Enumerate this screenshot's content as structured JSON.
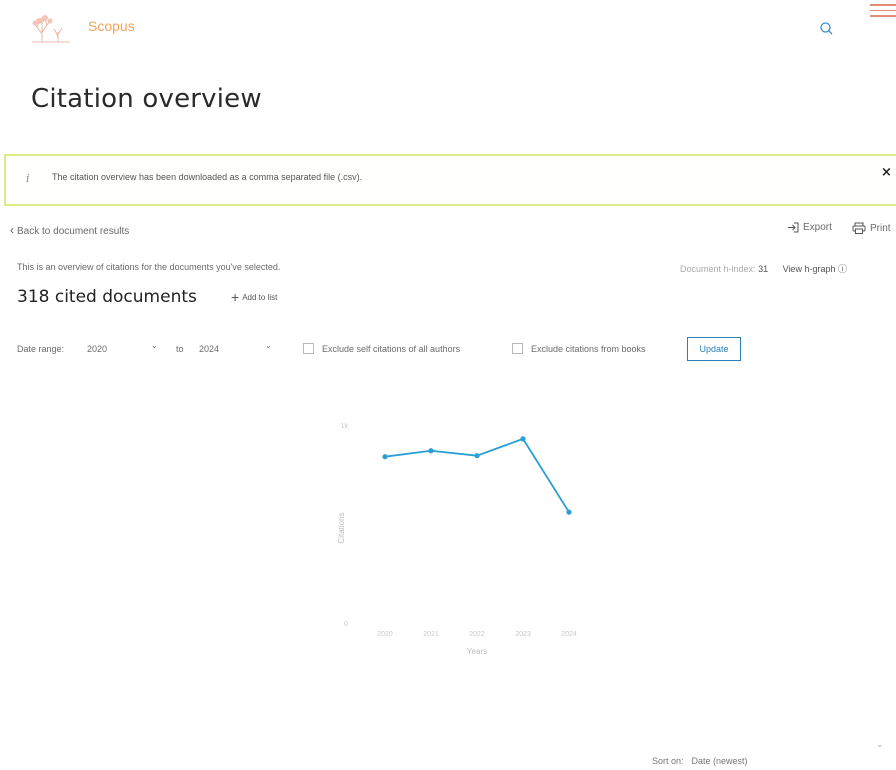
{
  "header": {
    "brand": "Scopus",
    "logo_icon": "tree-logo-icon",
    "search_icon": "search-icon",
    "menu_icon": "hamburger-menu-icon"
  },
  "page": {
    "title": "Citation overview"
  },
  "alert": {
    "icon": "i",
    "message": "The citation overview has been downloaded as a comma separated file (.csv).",
    "close": "×"
  },
  "nav": {
    "back": "Back to document results",
    "export": "Export",
    "print": "Print"
  },
  "summary": {
    "overview_text": "This is an overview of citations for the documents you've selected.",
    "hindex_label": "Document h-index:",
    "hindex_value": "31",
    "view_hgraph": "View h-graph",
    "cited_count": "318 cited documents",
    "add_to_list": "Add to list"
  },
  "filters": {
    "date_range_label": "Date range:",
    "from_value": "2020",
    "to_label": "to",
    "to_value": "2024",
    "exclude_self": "Exclude self citations of all authors",
    "exclude_books": "Exclude citations from books",
    "update": "Update"
  },
  "chart_data": {
    "type": "line",
    "x": [
      "2020",
      "2021",
      "2022",
      "2023",
      "2024"
    ],
    "values": [
      840,
      870,
      845,
      930,
      560
    ],
    "ylim": [
      0,
      1000
    ],
    "y_ticks": [
      "1k",
      "0"
    ],
    "xlabel": "Years",
    "ylabel": "Citations",
    "color": "#2a9fd6",
    "grid": false
  },
  "sort": {
    "label": "Sort on:",
    "value": "Date (newest)"
  }
}
